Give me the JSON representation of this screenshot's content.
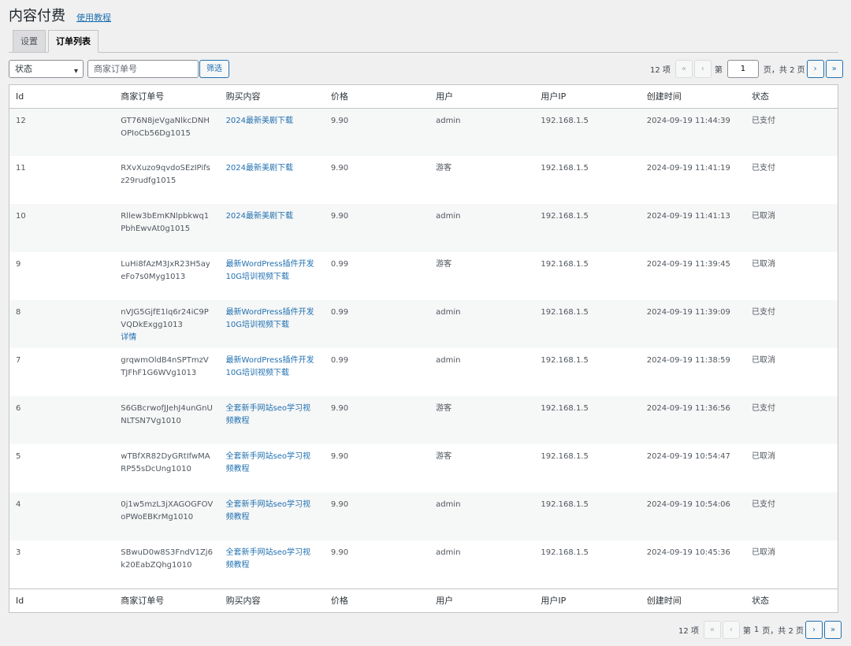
{
  "header": {
    "title": "内容付费",
    "help_link": "使用教程"
  },
  "tabs": [
    {
      "label": "设置"
    },
    {
      "label": "订单列表"
    }
  ],
  "filters": {
    "status_select": "状态",
    "search_placeholder": "商家订单号",
    "filter_button": "筛选"
  },
  "pagination_top": {
    "count": "12 项",
    "first": "«",
    "prev": "‹",
    "page_prefix": "第",
    "current_page": "1",
    "page_suffix": "页，共 2 页",
    "next": "›",
    "last": "»"
  },
  "pagination_bottom": {
    "count": "12 项",
    "first": "«",
    "prev": "‹",
    "page_prefix": "第",
    "current_page": "1",
    "page_suffix": "页，共 2 页",
    "next": "›",
    "last": "»"
  },
  "columns": [
    "Id",
    "商家订单号",
    "购买内容",
    "价格",
    "用户",
    "用户IP",
    "创建时间",
    "状态"
  ],
  "rows": [
    {
      "id": "12",
      "order": "GT76N8jeVgaNlkcDNHOPIoCb56Dg1015",
      "content": "2024最新美剧下载",
      "price": "9.90",
      "user": "admin",
      "ip": "192.168.1.5",
      "created": "2024-09-19 11:44:39",
      "status": "已支付",
      "detail": ""
    },
    {
      "id": "11",
      "order": "RXvXuzo9qvdoSEzIPifsz29rudfg1015",
      "content": "2024最新美剧下载",
      "price": "9.90",
      "user": "游客",
      "ip": "192.168.1.5",
      "created": "2024-09-19 11:41:19",
      "status": "已支付",
      "detail": ""
    },
    {
      "id": "10",
      "order": "Rllew3bEmKNlpbkwq1PbhEwvAt0g1015",
      "content": "2024最新美剧下载",
      "price": "9.90",
      "user": "admin",
      "ip": "192.168.1.5",
      "created": "2024-09-19 11:41:13",
      "status": "已取消",
      "detail": ""
    },
    {
      "id": "9",
      "order": "LuHi8fAzM3JxR23H5ayeFo7s0Myg1013",
      "content": "最新WordPress插件开发10G培训视频下载",
      "price": "0.99",
      "user": "游客",
      "ip": "192.168.1.5",
      "created": "2024-09-19 11:39:45",
      "status": "已取消",
      "detail": ""
    },
    {
      "id": "8",
      "order": "nVJG5GjfE1lq6r24iC9PVQDkExgg1013",
      "content": "最新WordPress插件开发10G培训视频下载",
      "price": "0.99",
      "user": "admin",
      "ip": "192.168.1.5",
      "created": "2024-09-19 11:39:09",
      "status": "已支付",
      "detail": "详情"
    },
    {
      "id": "7",
      "order": "grqwmOldB4nSPTmzVTJFhF1G6WVg1013",
      "content": "最新WordPress插件开发10G培训视频下载",
      "price": "0.99",
      "user": "admin",
      "ip": "192.168.1.5",
      "created": "2024-09-19 11:38:59",
      "status": "已取消",
      "detail": ""
    },
    {
      "id": "6",
      "order": "S6GBcrwofJJehJ4unGnUNLTSN7Vg1010",
      "content": "全套新手网站seo学习视频教程",
      "price": "9.90",
      "user": "游客",
      "ip": "192.168.1.5",
      "created": "2024-09-19 11:36:56",
      "status": "已支付",
      "detail": ""
    },
    {
      "id": "5",
      "order": "wTBfXR82DyGRtIfwMARP55sDcUng1010",
      "content": "全套新手网站seo学习视频教程",
      "price": "9.90",
      "user": "游客",
      "ip": "192.168.1.5",
      "created": "2024-09-19 10:54:47",
      "status": "已取消",
      "detail": ""
    },
    {
      "id": "4",
      "order": "0j1w5mzL3jXAGOGFOVoPWoEBKrMg1010",
      "content": "全套新手网站seo学习视频教程",
      "price": "9.90",
      "user": "admin",
      "ip": "192.168.1.5",
      "created": "2024-09-19 10:54:06",
      "status": "已支付",
      "detail": ""
    },
    {
      "id": "3",
      "order": "SBwuD0w8S3FndV1Zj6k20EabZQhg1010",
      "content": "全套新手网站seo学习视频教程",
      "price": "9.90",
      "user": "admin",
      "ip": "192.168.1.5",
      "created": "2024-09-19 10:45:36",
      "status": "已取消",
      "detail": ""
    }
  ]
}
